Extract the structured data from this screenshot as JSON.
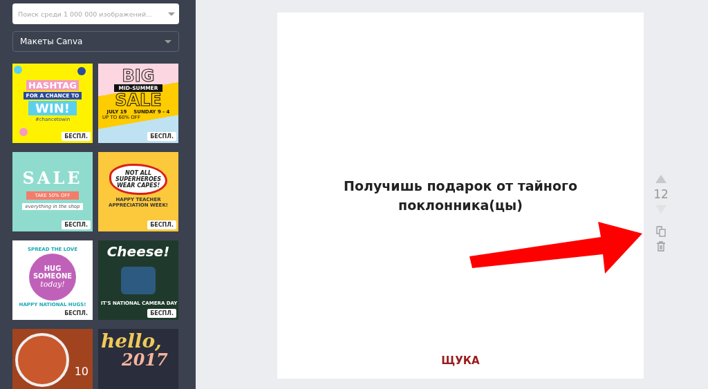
{
  "sidebar": {
    "search": {
      "placeholder": "Поиск среди 1 000 000 изображений..."
    },
    "category": {
      "value": "Макеты Canva"
    },
    "templates": [
      {
        "kind": "hashtag",
        "texts": [
          "HASHTAG",
          "FOR A CHANCE TO",
          "WIN!",
          "#chancetowin"
        ],
        "badge": "БЕСПЛ."
      },
      {
        "kind": "bigsale",
        "texts": [
          "BIG",
          "MID-SUMMER",
          "SALE",
          "JULY 19    SUNDAY 9 - 4",
          "UP TO 60% OFF"
        ],
        "badge": "БЕСПЛ."
      },
      {
        "kind": "sale",
        "texts": [
          "SALE",
          "TAKE 50% OFF",
          "everything in the shop"
        ],
        "badge": "БЕСПЛ."
      },
      {
        "kind": "heroes",
        "texts": [
          "NOT ALL",
          "SUPERHEROES",
          "WEAR CAPES!",
          "HAPPY TEACHER APPRECIATION WEEK!"
        ],
        "badge": "БЕСПЛ."
      },
      {
        "kind": "hug",
        "texts": [
          "SPREAD THE LOVE",
          "HUG",
          "SOMEONE",
          "today!",
          "HAPPY NATIONAL HUGS!"
        ],
        "badge": "БЕСПЛ."
      },
      {
        "kind": "cheese",
        "texts": [
          "Cheese!",
          "IT'S NATIONAL CAMERA DAY"
        ],
        "badge": "БЕСПЛ."
      },
      {
        "kind": "food",
        "texts": [
          "10"
        ]
      },
      {
        "kind": "hello",
        "texts": [
          "hello,",
          "2017"
        ]
      }
    ]
  },
  "page": {
    "heading": "Получишь подарок от тайного поклонника(цы)",
    "logo": "ЩУКА"
  },
  "page_tools": {
    "page_number": "12"
  }
}
